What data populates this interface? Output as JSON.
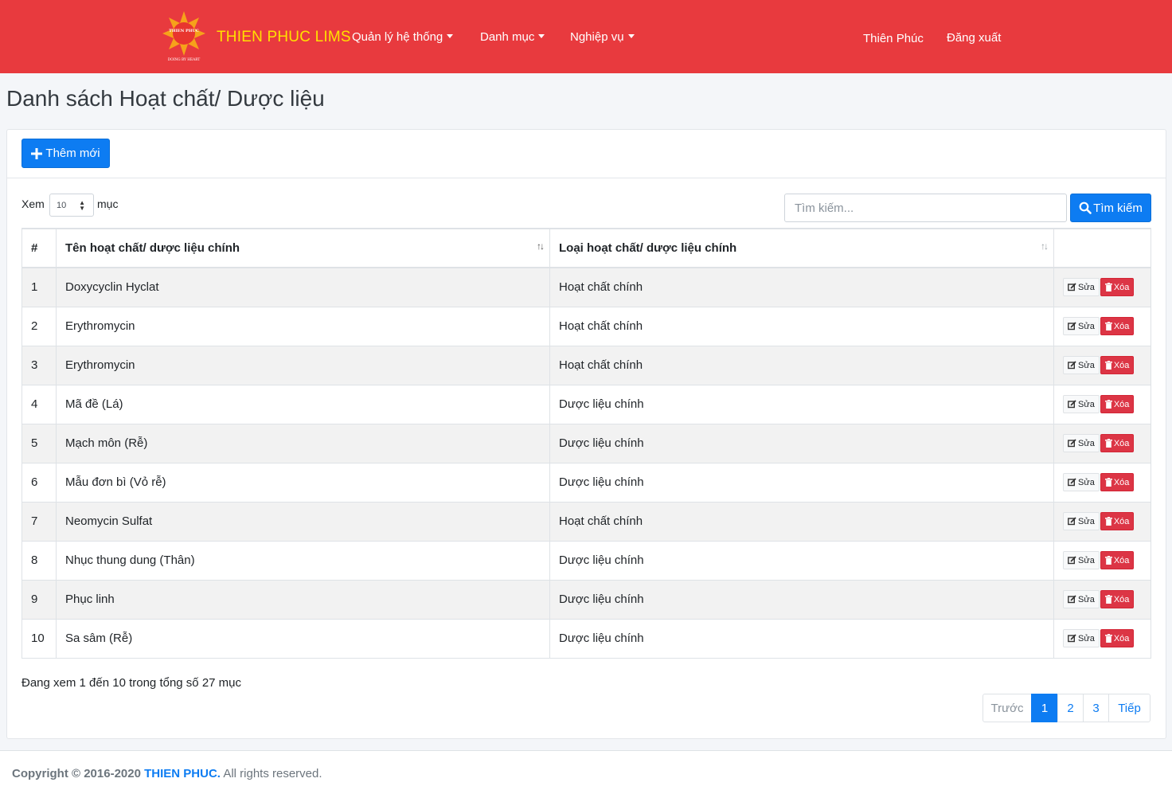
{
  "header": {
    "logo_text_top": "THIEN PHUC",
    "logo_text_bottom": "DOING BY HEART",
    "brand": "THIEN PHUC LIMS",
    "menu": [
      "Quản lý hệ thống",
      "Danh mục",
      "Nghiệp vụ"
    ],
    "user": "Thiên Phúc",
    "logout": "Đăng xuất"
  },
  "page": {
    "title": "Danh sách Hoạt chất/ Dược liệu",
    "add_button": "Thêm mới"
  },
  "table_controls": {
    "show_prefix": "Xem",
    "page_length": "10",
    "show_suffix": "mục",
    "search_placeholder": "Tìm kiếm...",
    "search_button": "Tìm kiếm"
  },
  "table": {
    "columns": [
      "#",
      "Tên hoạt chất/ dược liệu chính",
      "Loại hoạt chất/ dược liệu chính",
      ""
    ],
    "rows": [
      {
        "idx": "1",
        "name": "Doxycyclin Hyclat",
        "type": "Hoạt chất chính"
      },
      {
        "idx": "2",
        "name": "Erythromycin",
        "type": "Hoạt chất chính"
      },
      {
        "idx": "3",
        "name": "Erythromycin",
        "type": "Hoạt chất chính"
      },
      {
        "idx": "4",
        "name": "Mã đề (Lá)",
        "type": "Dược liệu chính"
      },
      {
        "idx": "5",
        "name": "Mạch môn (Rễ)",
        "type": "Dược liệu chính"
      },
      {
        "idx": "6",
        "name": "Mẫu đơn bì (Vỏ rễ)",
        "type": "Dược liệu chính"
      },
      {
        "idx": "7",
        "name": "Neomycin Sulfat",
        "type": "Hoạt chất chính"
      },
      {
        "idx": "8",
        "name": "Nhục thung dung (Thân)",
        "type": "Dược liệu chính"
      },
      {
        "idx": "9",
        "name": "Phục linh",
        "type": "Dược liệu chính"
      },
      {
        "idx": "10",
        "name": "Sa sâm (Rễ)",
        "type": "Dược liệu chính"
      }
    ],
    "edit_label": "Sửa",
    "delete_label": "Xóa"
  },
  "info": "Đang xem 1 đến 10 trong tổng số 27 mục",
  "pagination": {
    "prev": "Trước",
    "pages": [
      "1",
      "2",
      "3"
    ],
    "current": "1",
    "next": "Tiếp"
  },
  "footer": {
    "prefix": "Copyright © 2016-2020",
    "company": "THIEN PHUC.",
    "suffix": "All rights reserved."
  },
  "colors": {
    "navbar": "#e83a3e",
    "brand": "#ffe100",
    "primary": "#0d7cf2",
    "danger": "#dc3545"
  },
  "icons": {
    "add": "plus-icon",
    "search": "search-icon",
    "edit": "edit-icon",
    "delete": "trash-icon",
    "sort": "sort-icon"
  }
}
